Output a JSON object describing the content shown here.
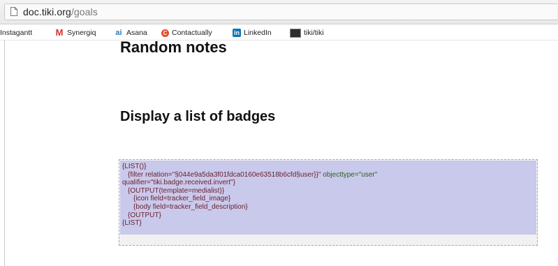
{
  "browser": {
    "url_host": "doc.tiki.org",
    "url_path": "/goals",
    "bookmarks": [
      {
        "label": "Instagantt",
        "icon": "none"
      },
      {
        "label": "Synergiq",
        "icon": "synergiq-m-icon"
      },
      {
        "label": "Asana",
        "icon": "asana-icon"
      },
      {
        "label": "Contactually",
        "icon": "contactually-icon"
      },
      {
        "label": "LinkedIn",
        "icon": "linkedin-icon"
      },
      {
        "label": "tiki/tiki",
        "icon": "tiki-icon"
      }
    ]
  },
  "page": {
    "heading_random": "Random notes",
    "heading_badges": "Display a list of badges",
    "code": {
      "line1": "{LIST()}",
      "line2a": "{filter relation=\"§044e9a5da3f01fdca0160e63518b6cfd§user}}\" ",
      "line2b": "objecttype=\"user\"",
      "line3": "qualifier=\"tiki.badge.received.invert\"}",
      "line4": "{OUTPUT(template=medialist)}",
      "line5": "{icon field=tracker_field_image}",
      "line6": "{body field=tracker_field_description}",
      "line7": "{OUTPUT}",
      "line8": "{LIST}"
    }
  },
  "colors": {
    "code_highlight": "#c9c9ec",
    "code_box_bg": "#f1f1f1",
    "linkedin": "#0b77b7",
    "synergiq": "#d9322b"
  }
}
